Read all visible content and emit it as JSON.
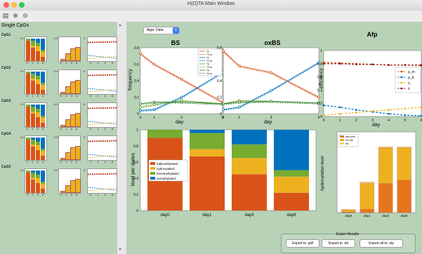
{
  "window": {
    "title": "H(O)TA Main Window"
  },
  "toolbar": {
    "icons": [
      "document-icon",
      "zoom-in-icon",
      "zoom-out-icon"
    ]
  },
  "left": {
    "title": "Single CpGs",
    "cpgs": [
      {
        "label": "CpG1"
      },
      {
        "label": "CpG2"
      },
      {
        "label": "CpG3"
      },
      {
        "label": "CpG4"
      },
      {
        "label": "CpG5"
      }
    ],
    "mini_ticks_bar": [
      "0",
      "1",
      "3",
      "6"
    ],
    "mini_y_top": "0.1",
    "mini_y_mid": "0.5",
    "mini_y_zero": "0"
  },
  "dropdown": {
    "value": "Appr. Data"
  },
  "colors": {
    "red": "#d95319",
    "blue": "#0072bd",
    "yellow": "#edb120",
    "green": "#77ac30",
    "darkgreen": "#2e7d32",
    "bg": "#b8d2b7"
  },
  "bs": {
    "title": "BS",
    "ylabel": "frequency",
    "yticks": [
      "0.8",
      "0.6",
      "0.4",
      "0.2",
      "0"
    ],
    "xticks": [
      "0",
      "1",
      "3",
      "6"
    ],
    "legend": [
      "T1",
      "T1 ar",
      "T2",
      "T2 ar",
      "T3",
      "T3 ar",
      "T4",
      "T4 ar"
    ]
  },
  "oxbs": {
    "title": "oxBS",
    "yticks": [
      "0.8",
      "0.6",
      "0.4",
      "0.2",
      "0"
    ],
    "xticks": [
      "0",
      "1",
      "3",
      "6"
    ]
  },
  "xlabel_day": "day",
  "afp": {
    "title": "Afp",
    "ylabel": "efficiency",
    "yticks": [
      "1",
      "0.8",
      "0.6",
      "0.4",
      "0.2",
      "0"
    ],
    "xticks": [
      "0",
      "1",
      "2",
      "3",
      "4",
      "5",
      "6"
    ],
    "legend": [
      "ρ_m",
      "ρ_d",
      "η",
      "λ"
    ]
  },
  "states": {
    "ylabel": "level per states",
    "yticks": [
      "1",
      "0.8",
      "0.6",
      "0.4",
      "0.2",
      "0"
    ],
    "categories": [
      "day0",
      "day1",
      "day3",
      "day6"
    ],
    "legend": [
      "fullymethylated",
      "hydroxylated",
      "hemimethylated",
      "unmethylated"
    ]
  },
  "hydro": {
    "ylabel": "hydroxylation level",
    "categories": [
      "day0",
      "day1",
      "day3",
      "day6"
    ],
    "legend": [
      "free sum",
      "uhr fhs",
      "fhs"
    ]
  },
  "export": {
    "group_title": "Export Results",
    "pdf": "Export to .pdf",
    "txt": "Export to .txt",
    "zip": "Export all to .zip"
  },
  "chart_data": [
    {
      "type": "line",
      "title": "BS",
      "xlabel": "day",
      "ylabel": "frequency",
      "x": [
        0,
        1,
        3,
        6
      ],
      "ylim": [
        0,
        0.8
      ],
      "series": [
        {
          "name": "T1",
          "values": [
            0.73,
            0.6,
            0.42,
            0.14
          ]
        },
        {
          "name": "T2",
          "values": [
            0.04,
            0.05,
            0.2,
            0.5
          ]
        },
        {
          "name": "T3",
          "values": [
            0.08,
            0.11,
            0.16,
            0.12
          ]
        },
        {
          "name": "T4",
          "values": [
            0.12,
            0.14,
            0.14,
            0.12
          ]
        }
      ]
    },
    {
      "type": "line",
      "title": "oxBS",
      "xlabel": "day",
      "x": [
        0,
        1,
        3,
        6
      ],
      "ylim": [
        0,
        0.8
      ],
      "series": [
        {
          "values": [
            0.76,
            0.58,
            0.5,
            0.2
          ]
        },
        {
          "values": [
            0.05,
            0.08,
            0.28,
            0.62
          ]
        },
        {
          "values": [
            0.12,
            0.16,
            0.15,
            0.13
          ]
        },
        {
          "values": [
            0.12,
            0.14,
            0.15,
            0.13
          ]
        }
      ]
    },
    {
      "type": "line",
      "title": "Afp",
      "xlabel": "day",
      "ylabel": "efficiency",
      "x": [
        0,
        1,
        2,
        3,
        4,
        5,
        6
      ],
      "ylim": [
        0,
        1
      ],
      "series": [
        {
          "name": "ρ_m",
          "values": [
            0.82,
            0.81,
            0.8,
            0.79,
            0.78,
            0.78,
            0.77
          ]
        },
        {
          "name": "ρ_d",
          "values": [
            0.17,
            0.14,
            0.1,
            0.07,
            0.04,
            0.02,
            0.01
          ]
        },
        {
          "name": "η",
          "values": [
            0.02,
            0.04,
            0.06,
            0.08,
            0.1,
            0.12,
            0.14
          ]
        },
        {
          "name": "λ",
          "values": [
            0.8,
            0.8,
            0.79,
            0.79,
            0.78,
            0.78,
            0.78
          ]
        }
      ]
    },
    {
      "type": "bar",
      "stacked": true,
      "ylabel": "level per states",
      "categories": [
        "day0",
        "day1",
        "day3",
        "day6"
      ],
      "ylim": [
        0,
        1
      ],
      "series": [
        {
          "name": "fullymethylated",
          "values": [
            0.9,
            0.67,
            0.45,
            0.22
          ]
        },
        {
          "name": "hydroxylated",
          "values": [
            0.0,
            0.09,
            0.2,
            0.2
          ]
        },
        {
          "name": "hemimethylated",
          "values": [
            0.1,
            0.2,
            0.17,
            0.08
          ]
        },
        {
          "name": "unmethylated",
          "values": [
            0.0,
            0.04,
            0.18,
            0.5
          ]
        }
      ]
    },
    {
      "type": "bar",
      "stacked": true,
      "ylabel": "hydroxylation level",
      "categories": [
        "day0",
        "day1",
        "day3",
        "day6"
      ],
      "ylim": [
        0,
        0.25
      ],
      "series": [
        {
          "name": "free sum",
          "values": [
            0.002,
            0.01,
            0.09,
            0.1
          ]
        },
        {
          "name": "uhr fhs",
          "values": [
            0.006,
            0.08,
            0.11,
            0.1
          ]
        },
        {
          "name": "fhs",
          "values": [
            0.002,
            0.005,
            0.004,
            0.004
          ]
        }
      ]
    }
  ]
}
